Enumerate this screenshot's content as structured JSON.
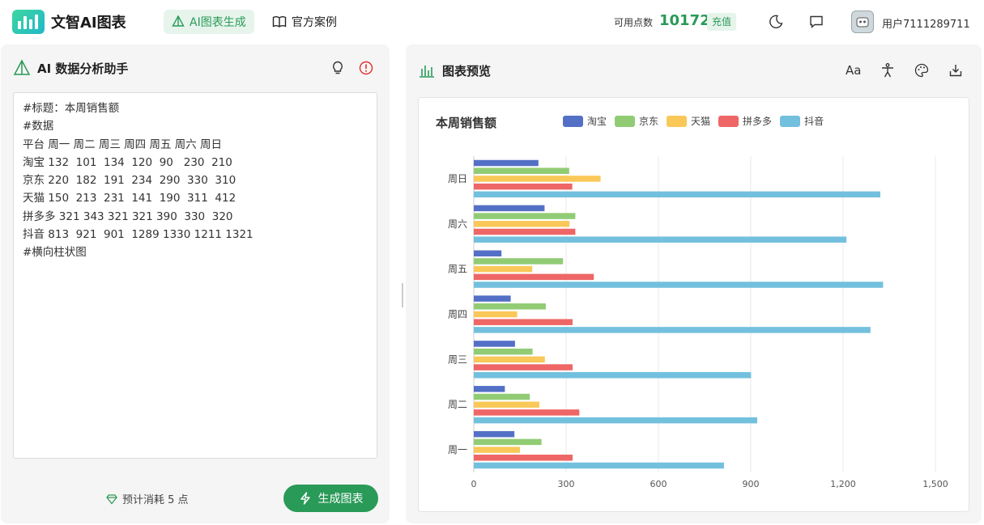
{
  "app": {
    "title": "文智AI图表"
  },
  "nav": {
    "tabs": [
      {
        "label": "AI图表生成",
        "icon": "pyramid-icon"
      },
      {
        "label": "官方案例",
        "icon": "book-icon"
      }
    ]
  },
  "account": {
    "points_label": "可用点数",
    "points_value": "10172",
    "recharge_label": "充值",
    "username": "用户7111289711"
  },
  "left_panel": {
    "title": "AI 数据分析助手",
    "input_text": "#标题：本周销售额\n#数据\n平台 周一 周二 周三 周四 周五 周六 周日\n淘宝 132  101  134  120  90   230  210\n京东 220  182  191  234  290  330  310\n天猫 150  213  231  141  190  311  412\n拼多多 321 343 321 321 390  330  320\n抖音 813  921  901  1289 1330 1211 1321\n#横向柱状图",
    "cost_label": "预计消耗 5 点",
    "generate_label": "生成图表"
  },
  "right_panel": {
    "title": "图表预览"
  },
  "colors": {
    "accent": "#2a9a58"
  },
  "chart_data": {
    "type": "bar",
    "orientation": "horizontal",
    "title": "本周销售额",
    "categories": [
      "周一",
      "周二",
      "周三",
      "周四",
      "周五",
      "周六",
      "周日"
    ],
    "series": [
      {
        "name": "淘宝",
        "color": "#5470c6",
        "values": [
          132,
          101,
          134,
          120,
          90,
          230,
          210
        ]
      },
      {
        "name": "京东",
        "color": "#91cc75",
        "values": [
          220,
          182,
          191,
          234,
          290,
          330,
          310
        ]
      },
      {
        "name": "天猫",
        "color": "#fac858",
        "values": [
          150,
          213,
          231,
          141,
          190,
          311,
          412
        ]
      },
      {
        "name": "拼多多",
        "color": "#ee6666",
        "values": [
          321,
          343,
          321,
          321,
          390,
          330,
          320
        ]
      },
      {
        "name": "抖音",
        "color": "#73c0de",
        "values": [
          813,
          921,
          901,
          1289,
          1330,
          1211,
          1321
        ]
      }
    ],
    "xlim": [
      0,
      1500
    ],
    "xticks": [
      "0",
      "300",
      "600",
      "900",
      "1,200",
      "1,500"
    ],
    "grid": true,
    "legend": "top"
  }
}
